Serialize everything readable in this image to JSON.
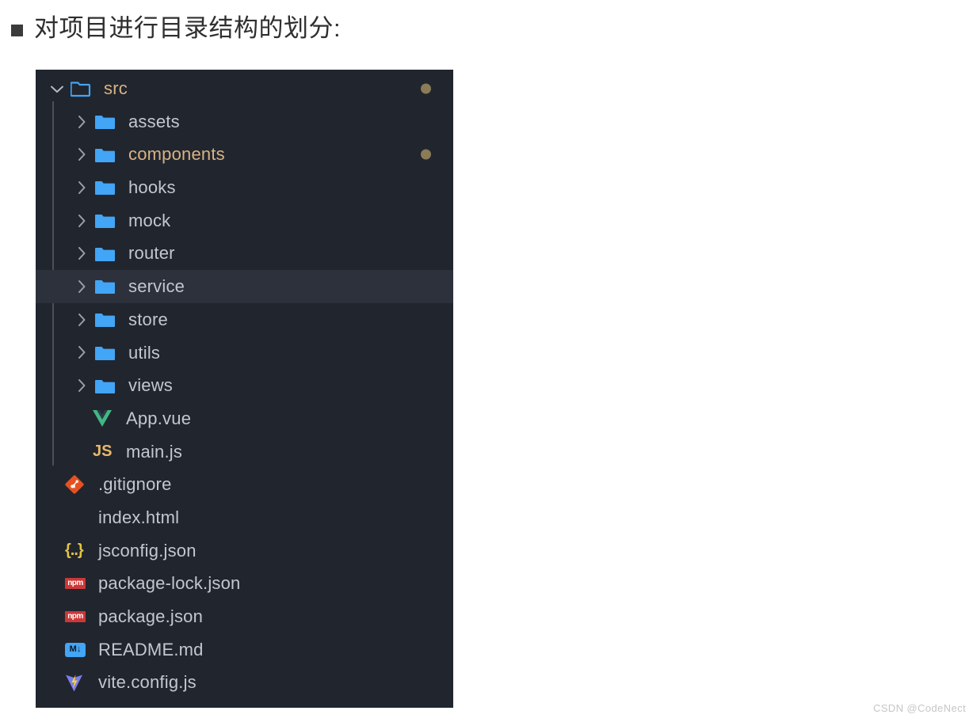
{
  "heading": {
    "bullet": "square-bullet",
    "text": "对项目进行目录结构的划分:"
  },
  "colors": {
    "panel_background": "#21252e",
    "row_hover": "#2c313c",
    "folder_blue": "#42a5f5",
    "text_default": "#c3c7cf",
    "text_modified": "#d8b384",
    "badge_dot": "#8b7b58",
    "indent_guide": "#4a4f5a",
    "heading_text": "#2f2f2f",
    "watermark": "#c6c6c6"
  },
  "explorer": {
    "rows": [
      {
        "label": "src",
        "type": "folder",
        "icon": "folder-open-icon",
        "level": 0,
        "expanded": true,
        "chevron": "chevron-down-icon",
        "color": "amber",
        "badge": true,
        "hovered": false
      },
      {
        "label": "assets",
        "type": "folder",
        "icon": "folder-icon",
        "level": 1,
        "expanded": false,
        "chevron": "chevron-right-icon",
        "color": "default",
        "badge": false,
        "hovered": false
      },
      {
        "label": "components",
        "type": "folder",
        "icon": "folder-icon",
        "level": 1,
        "expanded": false,
        "chevron": "chevron-right-icon",
        "color": "amber",
        "badge": true,
        "hovered": false
      },
      {
        "label": "hooks",
        "type": "folder",
        "icon": "folder-icon",
        "level": 1,
        "expanded": false,
        "chevron": "chevron-right-icon",
        "color": "default",
        "badge": false,
        "hovered": false
      },
      {
        "label": "mock",
        "type": "folder",
        "icon": "folder-icon",
        "level": 1,
        "expanded": false,
        "chevron": "chevron-right-icon",
        "color": "default",
        "badge": false,
        "hovered": false
      },
      {
        "label": "router",
        "type": "folder",
        "icon": "folder-icon",
        "level": 1,
        "expanded": false,
        "chevron": "chevron-right-icon",
        "color": "default",
        "badge": false,
        "hovered": false
      },
      {
        "label": "service",
        "type": "folder",
        "icon": "folder-icon",
        "level": 1,
        "expanded": false,
        "chevron": "chevron-right-icon",
        "color": "default",
        "badge": false,
        "hovered": true
      },
      {
        "label": "store",
        "type": "folder",
        "icon": "folder-icon",
        "level": 1,
        "expanded": false,
        "chevron": "chevron-right-icon",
        "color": "default",
        "badge": false,
        "hovered": false
      },
      {
        "label": "utils",
        "type": "folder",
        "icon": "folder-icon",
        "level": 1,
        "expanded": false,
        "chevron": "chevron-right-icon",
        "color": "default",
        "badge": false,
        "hovered": false
      },
      {
        "label": "views",
        "type": "folder",
        "icon": "folder-icon",
        "level": 1,
        "expanded": false,
        "chevron": "chevron-right-icon",
        "color": "default",
        "badge": false,
        "hovered": false
      },
      {
        "label": "App.vue",
        "type": "file",
        "icon": "vue-icon",
        "level": 1,
        "expanded": false,
        "chevron": "none",
        "color": "default",
        "badge": false,
        "hovered": false
      },
      {
        "label": "main.js",
        "type": "file",
        "icon": "js-icon",
        "level": 1,
        "expanded": false,
        "chevron": "none",
        "color": "default",
        "badge": false,
        "hovered": false
      },
      {
        "label": ".gitignore",
        "type": "file",
        "icon": "git-icon",
        "level": 0,
        "expanded": false,
        "chevron": "none",
        "color": "default",
        "badge": false,
        "hovered": false
      },
      {
        "label": "index.html",
        "type": "file",
        "icon": "html-icon",
        "level": 0,
        "expanded": false,
        "chevron": "none",
        "color": "default",
        "badge": false,
        "hovered": false
      },
      {
        "label": "jsconfig.json",
        "type": "file",
        "icon": "json-icon",
        "level": 0,
        "expanded": false,
        "chevron": "none",
        "color": "default",
        "badge": false,
        "hovered": false
      },
      {
        "label": "package-lock.json",
        "type": "file",
        "icon": "npm-icon",
        "level": 0,
        "expanded": false,
        "chevron": "none",
        "color": "default",
        "badge": false,
        "hovered": false
      },
      {
        "label": "package.json",
        "type": "file",
        "icon": "npm-icon",
        "level": 0,
        "expanded": false,
        "chevron": "none",
        "color": "default",
        "badge": false,
        "hovered": false
      },
      {
        "label": "README.md",
        "type": "file",
        "icon": "markdown-icon",
        "level": 0,
        "expanded": false,
        "chevron": "none",
        "color": "default",
        "badge": false,
        "hovered": false
      },
      {
        "label": "vite.config.js",
        "type": "file",
        "icon": "vite-icon",
        "level": 0,
        "expanded": false,
        "chevron": "none",
        "color": "default",
        "badge": false,
        "hovered": false
      }
    ],
    "icon_text": {
      "npm": "npm",
      "markdown": "M↓",
      "js": "JS",
      "html": "</>",
      "json": "{..}"
    }
  },
  "watermark": "CSDN @CodeNect"
}
